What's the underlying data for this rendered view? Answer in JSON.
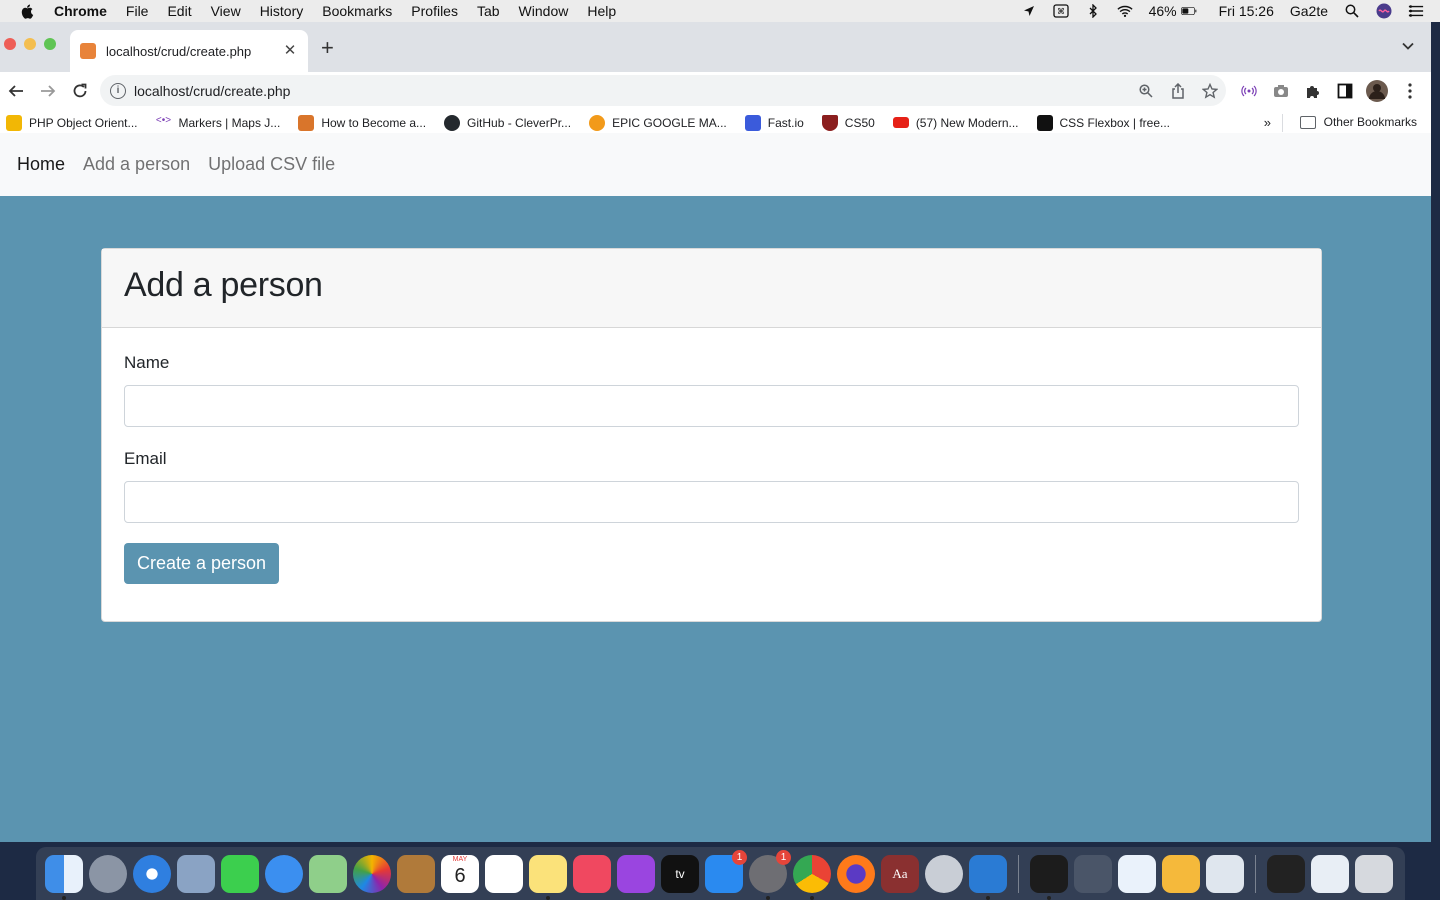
{
  "menubar": {
    "app_name": "Chrome",
    "items": [
      "File",
      "Edit",
      "View",
      "History",
      "Bookmarks",
      "Profiles",
      "Tab",
      "Window",
      "Help"
    ],
    "battery": "46%",
    "clock": "Fri 15:26",
    "user": "Ga2te"
  },
  "browser": {
    "tab_title": "localhost/crud/create.php",
    "url": "localhost/crud/create.php",
    "bookmarks": [
      {
        "label": "PHP Object Orient...",
        "color": "#f2b705"
      },
      {
        "label": "Markers  |  Maps J...",
        "color": "#ffffff"
      },
      {
        "label": "How to Become a...",
        "color": "#d9752b"
      },
      {
        "label": "GitHub - CleverPr...",
        "color": "#24292e"
      },
      {
        "label": "EPIC GOOGLE MA...",
        "color": "#f29a1a"
      },
      {
        "label": "Fast.io",
        "color": "#3b5bdb"
      },
      {
        "label": "CS50",
        "color": "#8b1e1e"
      },
      {
        "label": "(57) New Modern...",
        "color": "#e62117"
      },
      {
        "label": "CSS Flexbox | free...",
        "color": "#111111"
      }
    ],
    "more_label": "»",
    "other_bookmarks": "Other Bookmarks"
  },
  "page": {
    "nav": {
      "home": "Home",
      "add_person": "Add a person",
      "upload_csv": "Upload CSV file"
    },
    "card_title": "Add a person",
    "form": {
      "name_label": "Name",
      "name_value": "",
      "email_label": "Email",
      "email_value": "",
      "submit_label": "Create a person"
    }
  },
  "dock": {
    "calendar_month": "MAY",
    "calendar_day": "6",
    "app_store_badge": "1",
    "settings_badge": "1"
  },
  "colors": {
    "page_background": "#5b94b0",
    "button": "#5b94b0"
  }
}
